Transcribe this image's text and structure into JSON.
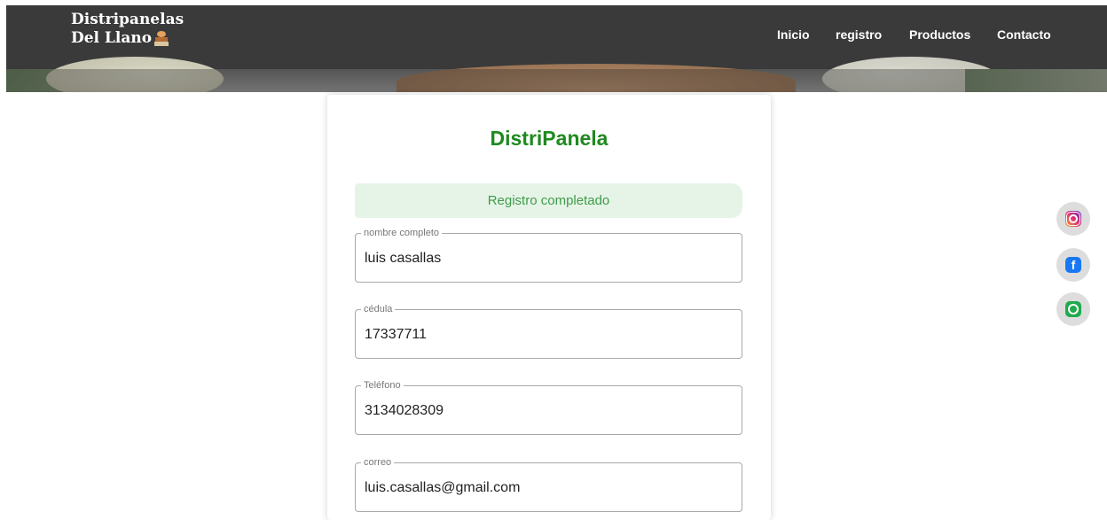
{
  "header": {
    "brand_line1": "Distripanelas",
    "brand_line2": "Del Llano",
    "nav": [
      {
        "label": "Inicio"
      },
      {
        "label": "registro"
      },
      {
        "label": "Productos"
      },
      {
        "label": "Contacto"
      }
    ]
  },
  "form": {
    "title": "DistriPanela",
    "alert": "Registro completado",
    "fields": [
      {
        "label": "nombre completo",
        "value": "luis casallas"
      },
      {
        "label": "cédula",
        "value": "17337711"
      },
      {
        "label": "Teléfono",
        "value": "3134028309"
      },
      {
        "label": "correo",
        "value": "luis.casallas@gmail.com"
      }
    ]
  },
  "social": {
    "items": [
      {
        "icon": "instagram-icon"
      },
      {
        "icon": "facebook-icon",
        "glyph": "f"
      },
      {
        "icon": "whatsapp-icon"
      }
    ]
  },
  "colors": {
    "header_bg": "#3a3a3a",
    "title_green": "#1e8a1e",
    "alert_bg": "#e6f4e7",
    "alert_text": "#3f9b4a"
  }
}
